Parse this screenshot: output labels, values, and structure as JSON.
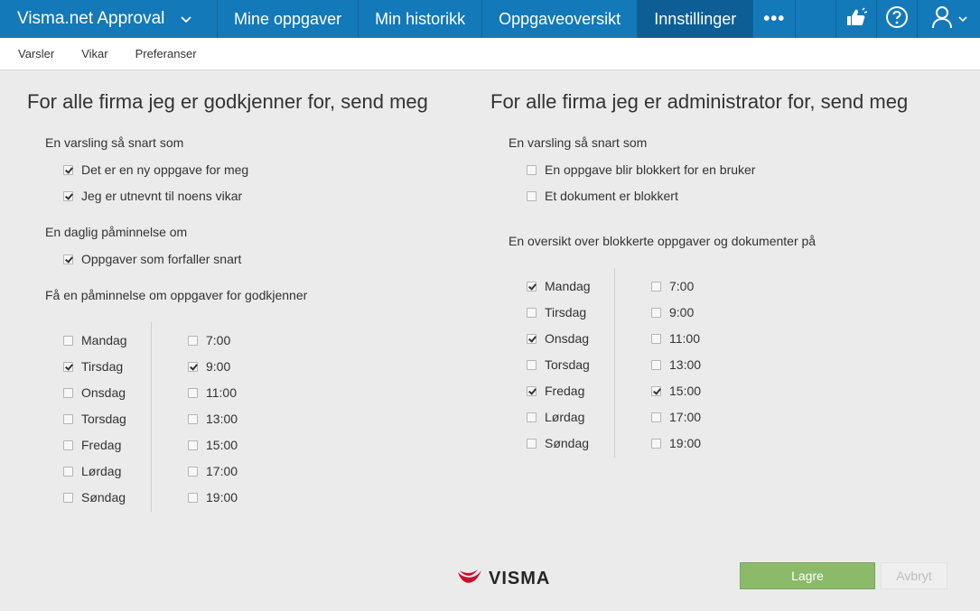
{
  "app": {
    "title": "Visma.net Approval"
  },
  "nav": [
    "Mine oppgaver",
    "Min historikk",
    "Oppgaveoversikt",
    "Innstillinger"
  ],
  "subnav": [
    "Varsler",
    "Vikar",
    "Preferanser"
  ],
  "left": {
    "heading": "For alle firma jeg er godkjenner for, send meg",
    "sec1": "En varsling så snart som",
    "opt1": {
      "label": "Det er en ny oppgave for meg",
      "checked": true
    },
    "opt2": {
      "label": "Jeg er utnevnt til noens vikar",
      "checked": true
    },
    "sec2": "En daglig påminnelse om",
    "opt3": {
      "label": "Oppgaver som forfaller snart",
      "checked": true
    },
    "sec3": "Få en påminnelse om oppgaver for godkjenner",
    "days": [
      {
        "label": "Mandag",
        "checked": false
      },
      {
        "label": "Tirsdag",
        "checked": true
      },
      {
        "label": "Onsdag",
        "checked": false
      },
      {
        "label": "Torsdag",
        "checked": false
      },
      {
        "label": "Fredag",
        "checked": false
      },
      {
        "label": "Lørdag",
        "checked": false
      },
      {
        "label": "Søndag",
        "checked": false
      }
    ],
    "times": [
      {
        "label": "7:00",
        "checked": false
      },
      {
        "label": "9:00",
        "checked": true
      },
      {
        "label": "11:00",
        "checked": false
      },
      {
        "label": "13:00",
        "checked": false
      },
      {
        "label": "15:00",
        "checked": false
      },
      {
        "label": "17:00",
        "checked": false
      },
      {
        "label": "19:00",
        "checked": false
      }
    ]
  },
  "right": {
    "heading": "For alle firma jeg er administrator for, send meg",
    "sec1": "En varsling så snart som",
    "opt1": {
      "label": "En oppgave blir blokkert for en bruker",
      "checked": false
    },
    "opt2": {
      "label": "Et dokument er blokkert",
      "checked": false
    },
    "sec2": "En oversikt over blokkerte oppgaver og dokumenter på",
    "days": [
      {
        "label": "Mandag",
        "checked": true
      },
      {
        "label": "Tirsdag",
        "checked": false
      },
      {
        "label": "Onsdag",
        "checked": true
      },
      {
        "label": "Torsdag",
        "checked": false
      },
      {
        "label": "Fredag",
        "checked": true
      },
      {
        "label": "Lørdag",
        "checked": false
      },
      {
        "label": "Søndag",
        "checked": false
      }
    ],
    "times": [
      {
        "label": "7:00",
        "checked": false
      },
      {
        "label": "9:00",
        "checked": false
      },
      {
        "label": "11:00",
        "checked": false
      },
      {
        "label": "13:00",
        "checked": false
      },
      {
        "label": "15:00",
        "checked": true
      },
      {
        "label": "17:00",
        "checked": false
      },
      {
        "label": "19:00",
        "checked": false
      }
    ]
  },
  "footer": {
    "logo": "VISMA",
    "save": "Lagre",
    "cancel": "Avbryt"
  },
  "colors": {
    "topbar": "#1479b8",
    "active_tab": "#0d5e95",
    "save_button": "#8bba6b",
    "logo_red": "#c8102e"
  }
}
